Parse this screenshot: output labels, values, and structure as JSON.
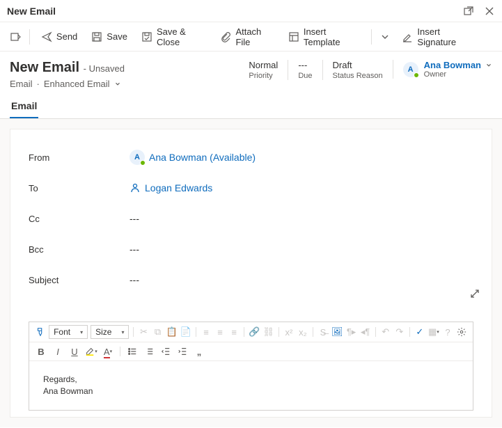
{
  "window": {
    "title": "New Email"
  },
  "commands": {
    "send": "Send",
    "save": "Save",
    "save_close": "Save & Close",
    "attach": "Attach File",
    "insert_template": "Insert Template",
    "insert_signature": "Insert Signature"
  },
  "header": {
    "title": "New Email",
    "status": "- Unsaved",
    "breadcrumb1": "Email",
    "breadcrumb2": "Enhanced Email",
    "stats": {
      "priority_val": "Normal",
      "priority_lbl": "Priority",
      "due_val": "---",
      "due_lbl": "Due",
      "status_val": "Draft",
      "status_lbl": "Status Reason"
    },
    "owner": {
      "initial": "A",
      "name": "Ana Bowman",
      "label": "Owner"
    }
  },
  "tab": "Email",
  "form": {
    "from_lbl": "From",
    "from_initial": "A",
    "from_val": "Ana Bowman (Available)",
    "to_lbl": "To",
    "to_val": "Logan Edwards",
    "cc_lbl": "Cc",
    "cc_val": "---",
    "bcc_lbl": "Bcc",
    "bcc_val": "---",
    "subject_lbl": "Subject",
    "subject_val": "---"
  },
  "editor": {
    "font_dd": "Font",
    "size_dd": "Size",
    "body": "Regards,\nAna Bowman"
  }
}
